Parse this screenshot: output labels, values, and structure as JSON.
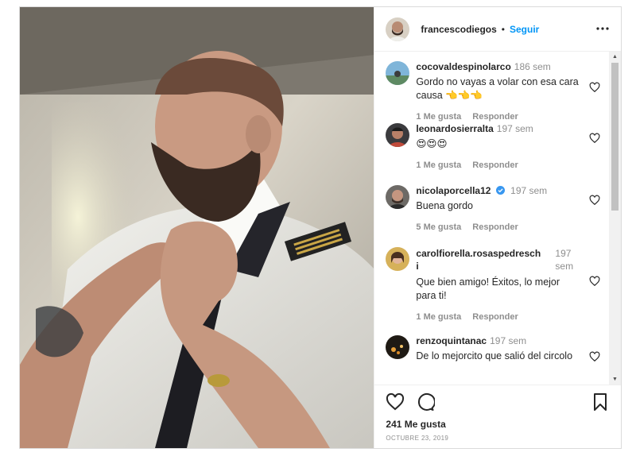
{
  "post": {
    "username": "francescodiegos",
    "separator": "•",
    "follow_label": "Seguir",
    "more_label": "•••",
    "likes": "241 Me gusta",
    "date": "OCTUBRE 23, 2019"
  },
  "comments": [
    {
      "user": "cocovaldespinolarco",
      "time": "186 sem",
      "text": "Gordo no vayas a volar con esa cara causa 👈👈👈",
      "likes": "1 Me gusta",
      "reply": "Responder"
    },
    {
      "user": "leonardosierralta",
      "time": "197 sem",
      "text": "😍😍😍",
      "likes": "1 Me gusta",
      "reply": "Responder"
    },
    {
      "user": "nicolaporcella12",
      "time": "197 sem",
      "text": "Buena gordo",
      "likes": "5 Me gusta",
      "reply": "Responder"
    },
    {
      "user": "carolfiorella.rosaspedreschi",
      "time": "197 sem",
      "text": "Que bien amigo! Éxitos, lo mejor para ti!",
      "likes": "1 Me gusta",
      "reply": "Responder"
    },
    {
      "user": "renzoquintanac",
      "time": "197 sem",
      "text": "De lo mejorcito que salió del circolo",
      "likes": "",
      "reply": ""
    }
  ],
  "colors": {
    "accent": "#0095f6",
    "verified": "#3897f0",
    "muted": "#8e8e8e"
  },
  "icons": [
    "heart-icon",
    "comment-icon",
    "bookmark-icon",
    "more-icon",
    "verified-icon"
  ]
}
